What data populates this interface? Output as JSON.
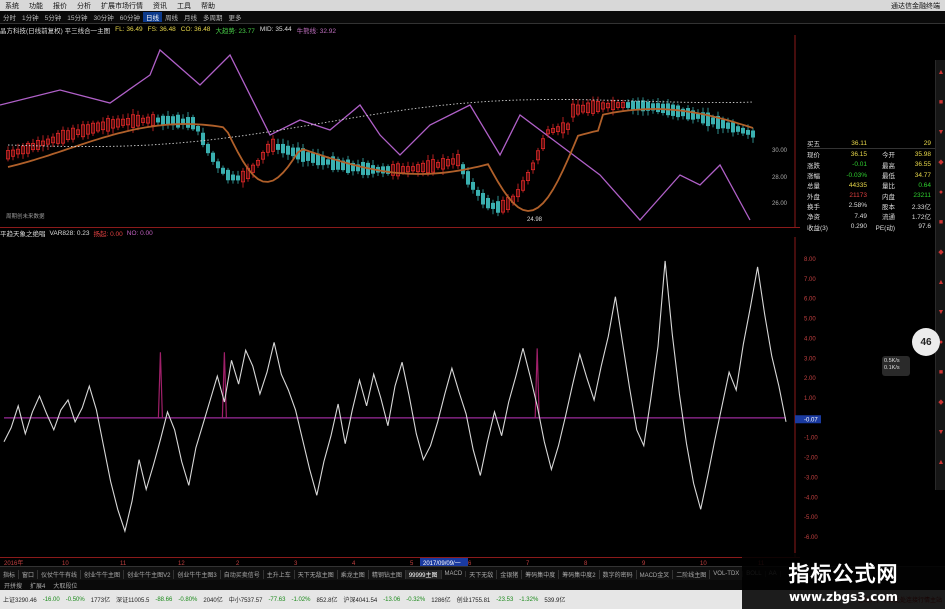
{
  "menubar": {
    "items": [
      "系统",
      "功能",
      "报价",
      "分析",
      "扩展市场行情",
      "资讯",
      "工具",
      "帮助"
    ],
    "title": "通达信金融终端"
  },
  "periodbar": {
    "items": [
      "分时",
      "1分钟",
      "5分钟",
      "15分钟",
      "30分钟",
      "60分钟",
      "日线",
      "周线",
      "月线",
      "多周期",
      "更多"
    ],
    "active": "日线"
  },
  "infobar": {
    "title": "晶方科技(日线前复权) 平三线合一主图",
    "fields": [
      "FL: 36.49",
      "FS: 36.48",
      "CO: 36.48",
      "大趋势: 23.77",
      "MID: 35.44",
      "牛熊线: 32.92"
    ]
  },
  "main_chart": {
    "price_ticks": [
      "30.00",
      "28.00",
      "26.00"
    ],
    "low_label": "24.98",
    "footer_label": "周期创未来数据"
  },
  "indicator": {
    "title": "平趋天象之绝唱",
    "fields": [
      "VAR828: 0.23",
      "扬起: 0.00",
      "NO: 0.00"
    ],
    "y_ticks": [
      "8.00",
      "7.00",
      "6.00",
      "5.00",
      "4.00",
      "3.00",
      "2.00",
      "1.00",
      "-0.07",
      "-1.00",
      "-2.00",
      "-3.00",
      "-4.00",
      "-5.00",
      "-6.00"
    ],
    "current": "-0.07"
  },
  "date_axis": {
    "labels": [
      "2016年",
      "10",
      "11",
      "12",
      "2",
      "3",
      "4",
      "5",
      "6",
      "7",
      "8",
      "9",
      "10",
      "11"
    ],
    "highlight": "2017/09/09/一"
  },
  "tabs": [
    "指标",
    "窗口",
    "仪仗牛牛有线",
    "创业牛牛主图",
    "创业牛牛主图V2",
    "创业牛牛主图3",
    "自动买卖信号",
    "主升上车",
    "天下无敌主图",
    "乘龙主图",
    "精钢钻主图",
    "99999主图",
    "MACD",
    "天下无敌",
    "金银猪",
    "筹码集中度",
    "筹码集中度2",
    "数字的密码",
    "MACD金叉",
    "二阶线主图",
    "VOL-TDX",
    "BOLL",
    "AA"
  ],
  "tabs_active": "99999主图",
  "tabs2": [
    "开拼搜",
    "扩展4",
    "大取段位"
  ],
  "statusbar": [
    "上证3290.46",
    "-16.00",
    "-0.50%",
    "1773亿",
    "深证11005.5",
    "-88.66",
    "-0.80%",
    "2040亿",
    "中小7537.57",
    "-77.63",
    "-1.02%",
    "852.8亿",
    "沪深4041.54",
    "-13.06",
    "-0.32%",
    "1286亿",
    "创业1755.81",
    "-23.53",
    "-1.32%",
    "539.9亿",
    "已断开，点击此处连接行情主站"
  ],
  "quote": {
    "header": {
      "label": "买五",
      "value": "36.11",
      "vol": "29"
    },
    "rows": [
      {
        "l1": "现价",
        "v1": "36.15",
        "l2": "今开",
        "v2": "35.98"
      },
      {
        "l1": "涨跌",
        "v1": "-0.01",
        "l2": "最高",
        "v2": "36.55"
      },
      {
        "l1": "涨幅",
        "v1": "-0.03%",
        "l2": "最低",
        "v2": "34.77"
      },
      {
        "l1": "总量",
        "v1": "44335",
        "l2": "量比",
        "v2": "0.64"
      },
      {
        "l1": "外盘",
        "v1": "21173",
        "l2": "内盘",
        "v2": "23211"
      },
      {
        "l1": "换手",
        "v1": "2.58%",
        "l2": "股本",
        "v2": "2.33亿"
      },
      {
        "l1": "净资",
        "v1": "7.49",
        "l2": "流通",
        "v2": "1.72亿"
      },
      {
        "l1": "收益(3)",
        "v1": "0.290",
        "l2": "PE(动)",
        "v2": "97.6"
      }
    ]
  },
  "float_ball": "46",
  "speed": [
    "0.5K/s",
    "0.1K/s"
  ],
  "watermark": {
    "title": "指标公式网",
    "url": "www.zbgs3.com"
  },
  "chart_data": {
    "type": "line",
    "series": [
      {
        "values": [
          -1.2,
          -0.5,
          0.6,
          -0.8,
          0.3,
          1.1,
          0.2,
          -0.6,
          0.4,
          0.9,
          -0.2,
          0.5,
          1.6,
          0.4,
          -1.4,
          -3.2,
          -4.6,
          -5.7,
          -4.2,
          -2.1,
          -3.6,
          -2.4,
          -1.1,
          0.3,
          -0.6,
          -2.2,
          -3.4,
          -1.5,
          -0.3,
          0.9,
          2.1,
          0.8,
          2.9,
          1.7,
          3.4,
          2.6,
          1.2,
          2.3,
          3.8,
          2.2,
          1.4,
          0.4,
          -1.1,
          -2.6,
          -3.9,
          -2.2,
          -0.9,
          0.7,
          -1.3,
          0.4,
          1.9,
          0.6,
          2.2,
          1.0,
          -0.4,
          1.6,
          2.8,
          1.1,
          -0.8,
          -2.1,
          -1.4,
          -0.2,
          1.2,
          2.5,
          1.3,
          0.2,
          -1.6,
          -2.9,
          -1.2,
          0.3,
          -0.9,
          0.8,
          2.1,
          3.5,
          2.1,
          0.6,
          -1.2,
          -2.6,
          -1.4,
          0.1,
          1.7,
          3.2,
          2.0,
          0.9,
          2.6,
          4.1,
          6.1,
          3.8,
          1.5,
          -0.6,
          -1.4,
          1.0,
          3.6,
          7.9,
          4.2,
          1.2,
          -1.3,
          -3.3,
          -4.6,
          -2.9,
          -1.1,
          0.6,
          2.3,
          1.4,
          3.7,
          5.6,
          7.6,
          5.2,
          3.1,
          1.6,
          -0.2
        ]
      },
      {
        "values": [
          0,
          0,
          0,
          0,
          0,
          0,
          0,
          0,
          0,
          0,
          0,
          0,
          0,
          0,
          0,
          0,
          0,
          0,
          0,
          0,
          0,
          0,
          0,
          0,
          0,
          0,
          0,
          0,
          0,
          0,
          0,
          0,
          0,
          0,
          0,
          0,
          0,
          0,
          0,
          0,
          0,
          0,
          0,
          0,
          0,
          0,
          0,
          0,
          0,
          0,
          0,
          0,
          0,
          0,
          0,
          0,
          0,
          0,
          0,
          0,
          0,
          0,
          0,
          0,
          0,
          0,
          0,
          0,
          0,
          0,
          0,
          0,
          0,
          0,
          0,
          0,
          0,
          0,
          0,
          0,
          0,
          0,
          0,
          0,
          0,
          0,
          0,
          0,
          0,
          0,
          0,
          0,
          0,
          0,
          0,
          0,
          0,
          0,
          0,
          0,
          0,
          0,
          0,
          0,
          0,
          0,
          0,
          0,
          0,
          0,
          0
        ]
      }
    ],
    "spikes": [
      {
        "index": 22,
        "value": 3.3
      },
      {
        "index": 31,
        "value": 3.3
      },
      {
        "index": 75,
        "value": 3.5
      }
    ],
    "ylim": [
      -6.5,
      8.5
    ],
    "colors": {
      "line": "#d8d8d8",
      "zero": "#9a2a9a",
      "spike": "#a0206a"
    }
  }
}
